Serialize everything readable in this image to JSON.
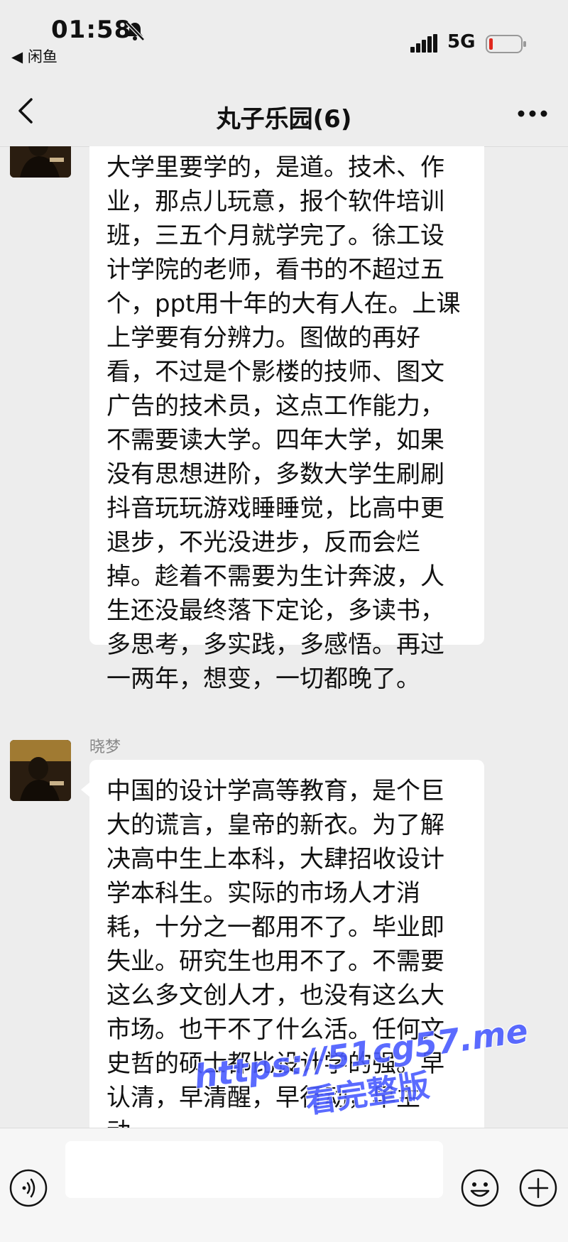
{
  "status_bar": {
    "time": "01:58",
    "back_app": "◀ 闲鱼",
    "network": "5G"
  },
  "header": {
    "title": "丸子乐园(6)"
  },
  "messages": [
    {
      "sender": "",
      "text": "大学里要学的，是道。技术、作业，那点儿玩意，报个软件培训班，三五个月就学完了。徐工设计学院的老师，看书的不超过五个，ppt用十年的大有人在。上课上学要有分辨力。图做的再好看，不过是个影楼的技师、图文广告的技术员，这点工作能力，不需要读大学。四年大学，如果没有思想进阶，多数大学生刷刷抖音玩玩游戏睡睡觉，比高中更退步，不光没进步，反而会烂掉。趁着不需要为生计奔波，人生还没最终落下定论，多读书，多思考，多实践，多感悟。再过一两年，想变，一切都晚了。"
    },
    {
      "sender": "晓梦",
      "text": "中国的设计学高等教育，是个巨大的谎言，皇帝的新衣。为了解决高中生上本科，大肆招收设计学本科生。实际的市场人才消耗，十分之一都用不了。毕业即失业。研究生也用不了。不需要这么多文创人才，也没有这么大市场。也干不了什么活。任何文史哲的硕士都比设计学的强。早认清，早清醒，早行动，早主动。"
    }
  ],
  "watermark": {
    "url": "https://51cg57.me",
    "label": "看完整版"
  },
  "colors": {
    "background": "#ededed",
    "bubble": "#ffffff",
    "watermark": "#4a5bff",
    "battery_low": "#e0281e"
  }
}
